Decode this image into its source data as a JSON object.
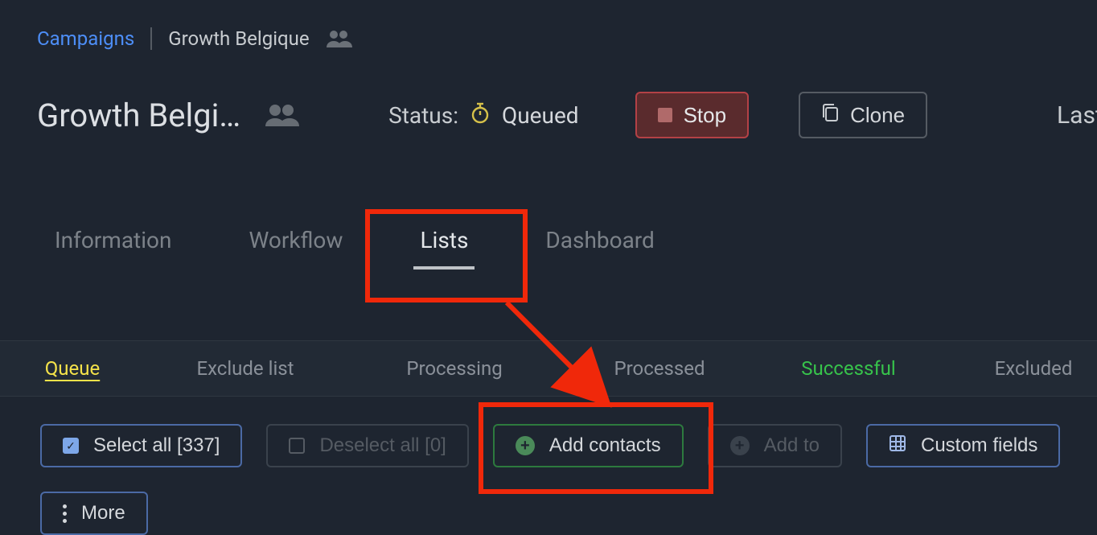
{
  "breadcrumb": {
    "root": "Campaigns",
    "campaign": "Growth Belgique"
  },
  "title": "Growth Belgi…",
  "status": {
    "label": "Status:",
    "value": "Queued"
  },
  "buttons": {
    "stop": "Stop",
    "clone": "Clone"
  },
  "last_label": "Last",
  "tabs": [
    {
      "label": "Information"
    },
    {
      "label": "Workflow"
    },
    {
      "label": "Lists",
      "active": true
    },
    {
      "label": "Dashboard"
    }
  ],
  "subtabs": {
    "queue": "Queue",
    "exclude": "Exclude list",
    "processing": "Processing",
    "processed": "Processed",
    "successful": "Successful",
    "excluded": "Excluded"
  },
  "actions": {
    "select_all": "Select all [337]",
    "deselect_all": "Deselect all [0]",
    "add_contacts": "Add contacts",
    "add_to": "Add to",
    "custom_fields": "Custom fields",
    "more": "More"
  }
}
